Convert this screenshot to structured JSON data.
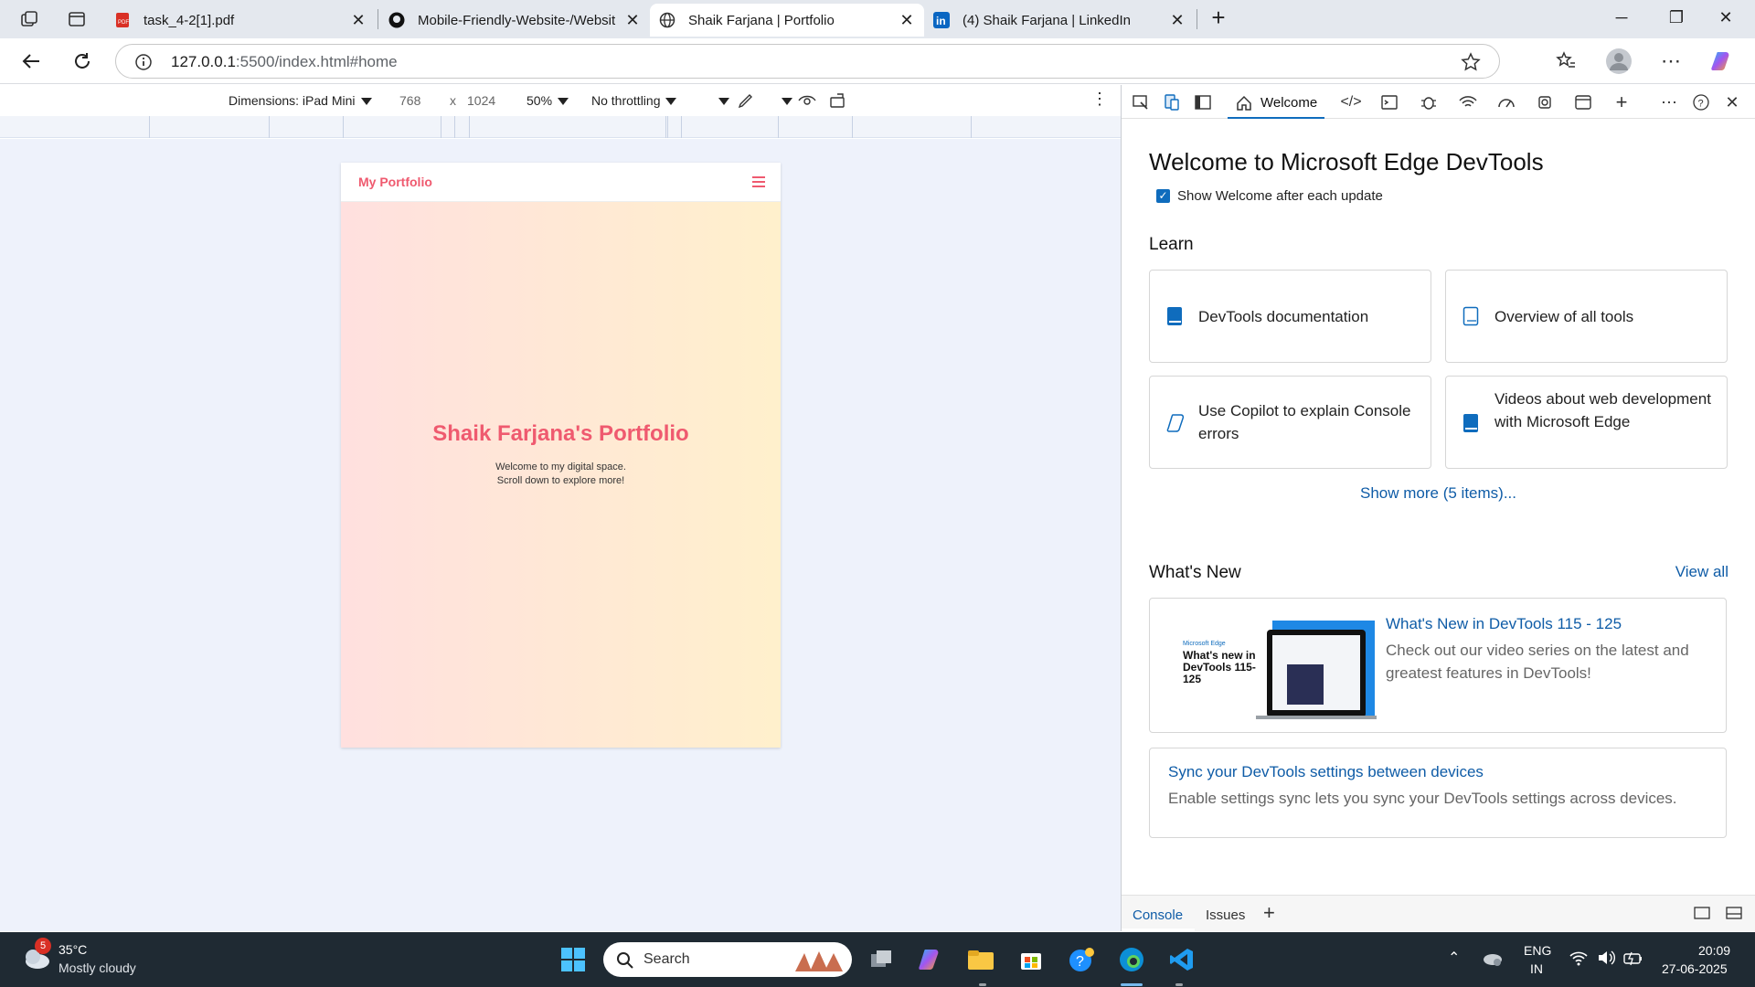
{
  "browser": {
    "tabs": [
      {
        "title": "task_4-2[1].pdf",
        "icon": "pdf-icon",
        "active": false
      },
      {
        "title": "Mobile-Friendly-Website-/Websit",
        "icon": "github-icon",
        "active": false
      },
      {
        "title": "Shaik Farjana | Portfolio",
        "icon": "globe-icon",
        "active": true
      },
      {
        "title": "(4) Shaik Farjana | LinkedIn",
        "icon": "linkedin-icon",
        "active": false
      }
    ],
    "url_host": "127.0.0.1",
    "url_path": ":5500/index.html#home"
  },
  "device_toolbar": {
    "dimensions": "Dimensions: iPad Mini",
    "width": "768",
    "times": "x",
    "height": "1024",
    "zoom": "50%",
    "throttle": "No throttling"
  },
  "page": {
    "logo": "My Portfolio",
    "title": "Shaik Farjana's Portfolio",
    "sub1": "Welcome to my digital space.",
    "sub2": "Scroll down to explore more!"
  },
  "devtools": {
    "tab_welcome": "Welcome",
    "heading": "Welcome to Microsoft Edge DevTools",
    "show_welcome": "Show Welcome after each update",
    "learn": "Learn",
    "learn_cards": [
      "DevTools documentation",
      "Overview of all tools",
      "Use Copilot to explain Console errors",
      "Videos about web development with Microsoft Edge"
    ],
    "show_more": "Show more (5 items)...",
    "whats_new": "What's New",
    "view_all": "View all",
    "news1_title": "What's New in DevTools 115 - 125",
    "news1_desc": "Check out our video series on the latest and greatest features in DevTools!",
    "news1_thumb_brand": "Microsoft Edge",
    "news1_thumb_text": "What's new in DevTools 115-125",
    "news2_title": "Sync your DevTools settings between devices",
    "news2_desc": "Enable settings sync lets you sync your DevTools settings across devices.",
    "bottom_console": "Console",
    "bottom_issues": "Issues"
  },
  "taskbar": {
    "weather_temp": "35°C",
    "weather_desc": "Mostly cloudy",
    "weather_badge": "5",
    "search": "Search",
    "lang1": "ENG",
    "lang2": "IN",
    "time": "20:09",
    "date": "27-06-2025"
  },
  "colors": {
    "accent": "#0f6cbd",
    "portfolio": "#ef5a6f",
    "link": "#0f5ca7"
  }
}
